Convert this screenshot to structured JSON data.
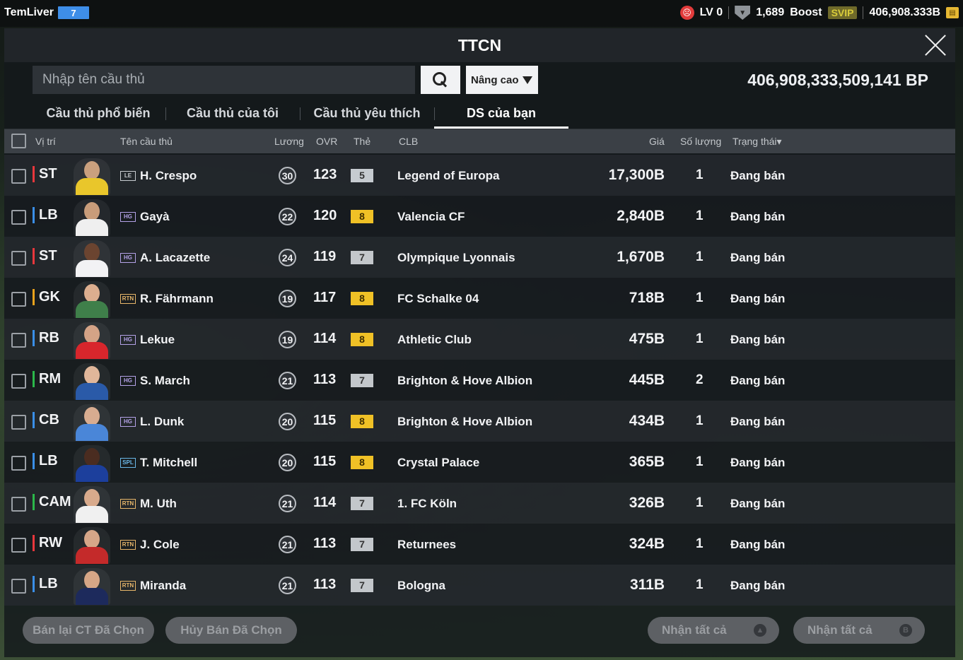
{
  "topbar": {
    "username": "TemLiver",
    "level_badge": "7",
    "lv_text": "LV 0",
    "trophy_count": "1,689",
    "boost_label": "Boost",
    "svip_label": "SVIP",
    "balance": "406,908.333B"
  },
  "dialog": {
    "title": "TTCN"
  },
  "search": {
    "placeholder": "Nhập tên cầu thủ",
    "advanced_label": "Nâng cao",
    "bp_total": "406,908,333,509,141 BP"
  },
  "tabs": [
    {
      "label": "Cầu thủ phổ biến",
      "active": false
    },
    {
      "label": "Cầu thủ của tôi",
      "active": false
    },
    {
      "label": "Cầu thủ yêu thích",
      "active": false
    },
    {
      "label": "DS của bạn",
      "active": true
    }
  ],
  "columns": {
    "position": "Vị trí",
    "name": "Tên cầu thủ",
    "wage": "Lương",
    "ovr": "OVR",
    "grade": "Thẻ",
    "club": "CLB",
    "price": "Giá",
    "quantity": "Số lượng",
    "status": "Trạng thái▾"
  },
  "colors": {
    "attacker": "#e8373c",
    "midfielder": "#2bb84a",
    "defender": "#3a8fe8",
    "goalkeeper": "#e8a21c"
  },
  "rows": [
    {
      "position": "ST",
      "pos_color": "#e8373c",
      "badge": "LE",
      "badge_color": "#c8ccd0",
      "name": "H. Crespo",
      "wage": "30",
      "ovr": "123",
      "grade": "5",
      "grade_class": "g5",
      "club": "Legend of Europa",
      "price": "17,300B",
      "quantity": "1",
      "status": "Đang bán",
      "kit": "#e9c62b",
      "skin": "#caa07e"
    },
    {
      "position": "LB",
      "pos_color": "#3a8fe8",
      "badge": "HG",
      "badge_color": "#b4a2e8",
      "name": "Gayà",
      "wage": "22",
      "ovr": "120",
      "grade": "8",
      "grade_class": "g8",
      "club": "Valencia CF",
      "price": "2,840B",
      "quantity": "1",
      "status": "Đang bán",
      "kit": "#efefef",
      "skin": "#c89c7a"
    },
    {
      "position": "ST",
      "pos_color": "#e8373c",
      "badge": "HG",
      "badge_color": "#b4a2e8",
      "name": "A. Lacazette",
      "wage": "24",
      "ovr": "119",
      "grade": "7",
      "grade_class": "g7",
      "club": "Olympique Lyonnais",
      "price": "1,670B",
      "quantity": "1",
      "status": "Đang bán",
      "kit": "#f2f2f4",
      "skin": "#6b4430"
    },
    {
      "position": "GK",
      "pos_color": "#e8a21c",
      "badge": "RTN",
      "badge_color": "#e8b76a",
      "name": "R. Fährmann",
      "wage": "19",
      "ovr": "117",
      "grade": "8",
      "grade_class": "g8",
      "club": "FC Schalke 04",
      "price": "718B",
      "quantity": "1",
      "status": "Đang bán",
      "kit": "#3f7f4a",
      "skin": "#dcae8f"
    },
    {
      "position": "RB",
      "pos_color": "#3a8fe8",
      "badge": "HG",
      "badge_color": "#b4a2e8",
      "name": "Lekue",
      "wage": "19",
      "ovr": "114",
      "grade": "8",
      "grade_class": "g8",
      "club": "Athletic Club",
      "price": "475B",
      "quantity": "1",
      "status": "Đang bán",
      "kit": "#d8262c",
      "skin": "#d4a386"
    },
    {
      "position": "RM",
      "pos_color": "#2bb84a",
      "badge": "HG",
      "badge_color": "#b4a2e8",
      "name": "S. March",
      "wage": "21",
      "ovr": "113",
      "grade": "7",
      "grade_class": "g7",
      "club": "Brighton & Hove Albion",
      "price": "445B",
      "quantity": "2",
      "status": "Đang bán",
      "kit": "#2a5aa8",
      "skin": "#e0b69a"
    },
    {
      "position": "CB",
      "pos_color": "#3a8fe8",
      "badge": "HG",
      "badge_color": "#b4a2e8",
      "name": "L. Dunk",
      "wage": "20",
      "ovr": "115",
      "grade": "8",
      "grade_class": "g8",
      "club": "Brighton & Hove Albion",
      "price": "434B",
      "quantity": "1",
      "status": "Đang bán",
      "kit": "#4a86d8",
      "skin": "#d8ac90"
    },
    {
      "position": "LB",
      "pos_color": "#3a8fe8",
      "badge": "SPL",
      "badge_color": "#6ab8e8",
      "name": "T. Mitchell",
      "wage": "20",
      "ovr": "115",
      "grade": "8",
      "grade_class": "g8",
      "club": "Crystal Palace",
      "price": "365B",
      "quantity": "1",
      "status": "Đang bán",
      "kit": "#1c3f9c",
      "skin": "#4a2c20"
    },
    {
      "position": "CAM",
      "pos_color": "#2bb84a",
      "badge": "RTN",
      "badge_color": "#e8b76a",
      "name": "M. Uth",
      "wage": "21",
      "ovr": "114",
      "grade": "7",
      "grade_class": "g7",
      "club": "1. FC Köln",
      "price": "326B",
      "quantity": "1",
      "status": "Đang bán",
      "kit": "#f0f0f0",
      "skin": "#d8aa8c"
    },
    {
      "position": "RW",
      "pos_color": "#e8373c",
      "badge": "RTN",
      "badge_color": "#e8b76a",
      "name": "J. Cole",
      "wage": "21",
      "ovr": "113",
      "grade": "7",
      "grade_class": "g7",
      "club": "Returnees",
      "price": "324B",
      "quantity": "1",
      "status": "Đang bán",
      "kit": "#c42a2a",
      "skin": "#d6a688"
    },
    {
      "position": "LB",
      "pos_color": "#3a8fe8",
      "badge": "RTN",
      "badge_color": "#e8b76a",
      "name": "Miranda",
      "wage": "21",
      "ovr": "113",
      "grade": "7",
      "grade_class": "g7",
      "club": "Bologna",
      "price": "311B",
      "quantity": "1",
      "status": "Đang bán",
      "kit": "#1d2a5c",
      "skin": "#d6a686"
    }
  ],
  "footer": {
    "resell_label": "Bán lại CT Đã Chọn",
    "cancel_label": "Hủy Bán Đã Chọn",
    "claim_all_1": "Nhận tất cả",
    "claim_all_2": "Nhận tất cả"
  }
}
